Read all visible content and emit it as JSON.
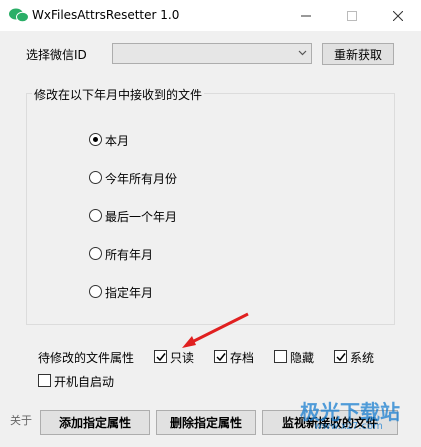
{
  "window": {
    "title": "WxFilesAttrsResetter 1.0"
  },
  "wechat": {
    "label": "选择微信ID",
    "selected": "",
    "refresh_label": "重新获取"
  },
  "period": {
    "group_label": "修改在以下年月中接收到的文件",
    "options": [
      {
        "label": "本月",
        "selected": true
      },
      {
        "label": "今年所有月份",
        "selected": false
      },
      {
        "label": "最后一个年月",
        "selected": false
      },
      {
        "label": "所有年月",
        "selected": false
      },
      {
        "label": "指定年月",
        "selected": false
      }
    ]
  },
  "attributes": {
    "label": "待修改的文件属性",
    "items": [
      {
        "label": "只读",
        "checked": true
      },
      {
        "label": "存档",
        "checked": true
      },
      {
        "label": "隐藏",
        "checked": false
      },
      {
        "label": "系统",
        "checked": true
      }
    ]
  },
  "autostart": {
    "label": "开机自启动",
    "checked": false
  },
  "footer": {
    "about_label": "关于",
    "add_label": "添加指定属性",
    "remove_label": "删除指定属性",
    "monitor_label": "监视新接收的文件"
  },
  "watermark": {
    "text": "极光下载站",
    "url": "www.xz7.com"
  },
  "colors": {
    "annotation_arrow": "#e02020",
    "watermark": "#1a7fd1",
    "wechat_icon": "#2aae67"
  }
}
